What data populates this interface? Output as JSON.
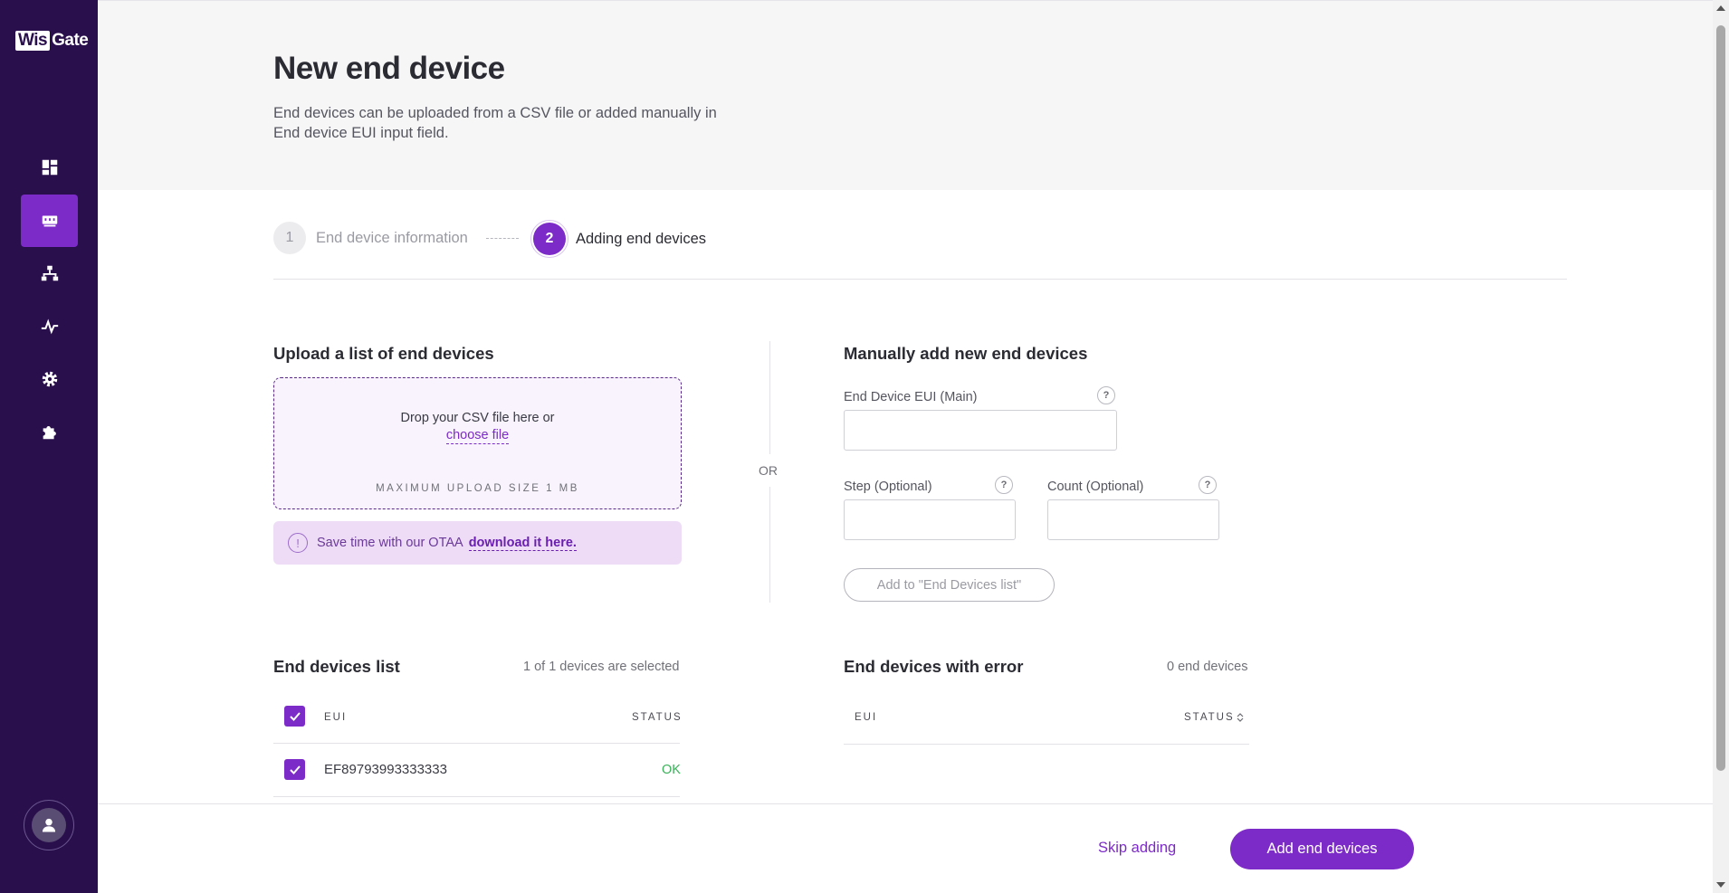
{
  "brand": {
    "logo_part1": "Wis",
    "logo_part2": "Gate"
  },
  "sidebar": {
    "items": [
      {
        "icon": "dashboard-icon"
      },
      {
        "icon": "gateway-icon",
        "active": true
      },
      {
        "icon": "network-icon"
      },
      {
        "icon": "activity-icon"
      },
      {
        "icon": "gear-icon"
      },
      {
        "icon": "puzzle-icon"
      }
    ],
    "avatar_icon": "user-icon"
  },
  "header": {
    "title": "New end device",
    "description": "End devices can be uploaded from a CSV file or added manually in End device EUI input field."
  },
  "stepper": {
    "step1": {
      "number": "1",
      "label": "End device information"
    },
    "step2": {
      "number": "2",
      "label": "Adding end devices"
    }
  },
  "upload": {
    "title": "Upload a list of end devices",
    "drop_text": "Drop your CSV file here or",
    "choose_file": "choose file",
    "max_size": "MAXIMUM UPLOAD SIZE 1 MB",
    "otaa_text": "Save time with our OTAA",
    "otaa_link": "download it here."
  },
  "divider": {
    "or": "OR"
  },
  "manual": {
    "title": "Manually add new end devices",
    "eui_label": "End Device EUI (Main)",
    "step_label": "Step (Optional)",
    "count_label": "Count (Optional)",
    "help": "?",
    "eui_value": "",
    "step_value": "",
    "count_value": "",
    "add_button": "Add to \"End Devices list\""
  },
  "devices_list": {
    "title": "End devices list",
    "meta": "1 of 1 devices are selected",
    "col_eui": "EUI",
    "col_status": "STATUS",
    "rows": [
      {
        "eui": "EF89793993333333",
        "status": "OK",
        "checked": true
      }
    ]
  },
  "errors_list": {
    "title": "End devices with error",
    "meta": "0 end devices",
    "col_eui": "EUI",
    "col_status": "STATUS"
  },
  "footer": {
    "skip": "Skip adding",
    "primary": "Add end devices"
  },
  "colors": {
    "sidebar": "#2a0f4d",
    "accent": "#7d2bc8",
    "ok": "#3bb15a"
  }
}
